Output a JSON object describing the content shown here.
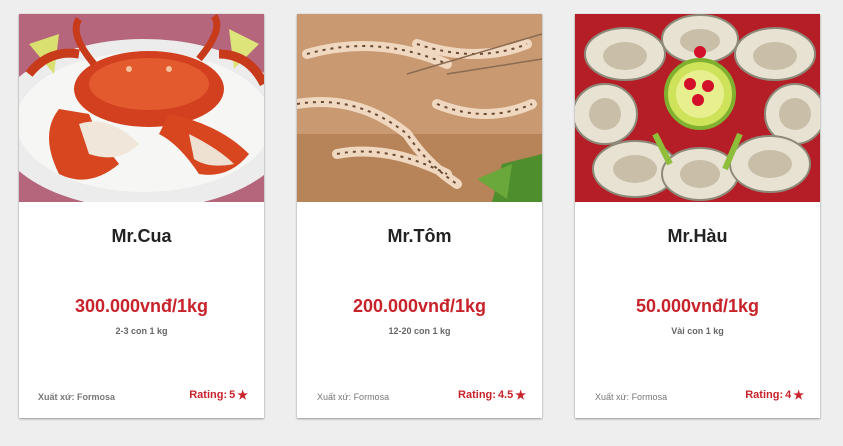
{
  "products": [
    {
      "name": "Mr.Cua",
      "image_icon": "crab-photo",
      "price": "300.000vnđ/1kg",
      "count": "2-3 con 1 kg",
      "origin_label": "Xuất xứ:",
      "origin_value": "Formosa",
      "rating_label": "Rating:",
      "rating_value": "5"
    },
    {
      "name": "Mr.Tôm",
      "image_icon": "shrimp-photo",
      "price": "200.000vnđ/1kg",
      "count": "12-20 con 1 kg",
      "origin_label": "Xuất xứ:",
      "origin_value": "Formosa",
      "rating_label": "Rating:",
      "rating_value": "4.5"
    },
    {
      "name": "Mr.Hàu",
      "image_icon": "oyster-photo",
      "price": "50.000vnđ/1kg",
      "count": "Vài con 1 kg",
      "origin_label": "Xuất xứ:",
      "origin_value": "Formosa",
      "rating_label": "Rating:",
      "rating_value": "4"
    }
  ],
  "colors": {
    "accent": "#c8222a",
    "background": "#eeeeee",
    "card": "#ffffff"
  },
  "icons": {
    "rating_star": "star-icon"
  }
}
